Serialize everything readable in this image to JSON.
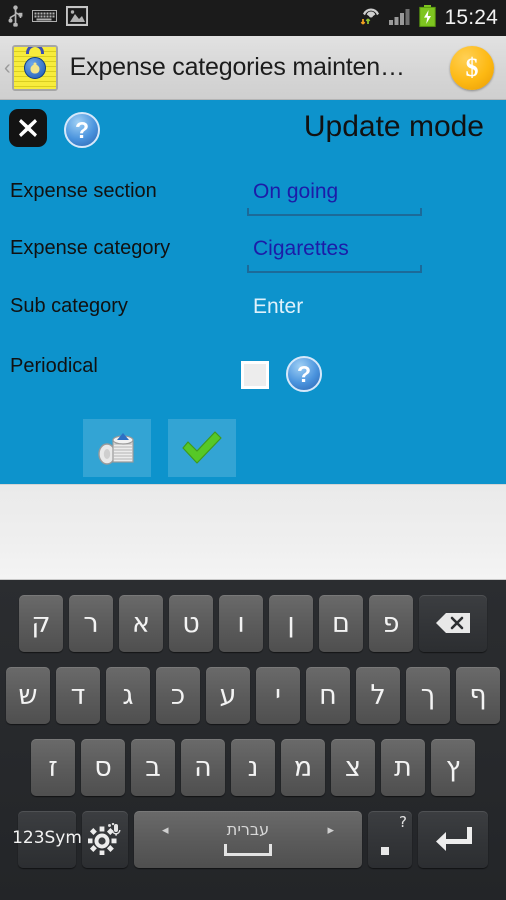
{
  "statusbar": {
    "icons": [
      "usb-icon",
      "keyboard-icon",
      "screenshot-image-icon"
    ],
    "right_icons": [
      "wifi-data-icon",
      "cellular-signal-icon",
      "battery-charging-icon"
    ],
    "clock": "15:24"
  },
  "titlebar": {
    "back_chevron": "‹",
    "app_icon": "expense-clipboard-icon",
    "title": "Expense categories mainten…",
    "coin_symbol": "$"
  },
  "form": {
    "close_label": "✕",
    "help_label": "?",
    "mode_title": "Update mode",
    "fields": [
      {
        "label": "Expense section",
        "value": "On going",
        "style": "underlined"
      },
      {
        "label": "Expense category",
        "value": "Cigarettes",
        "style": "underlined"
      },
      {
        "label": "Sub category",
        "value": "Enter",
        "style": "placeholder"
      }
    ],
    "periodical": {
      "label": "Periodical",
      "checked": false,
      "help_label": "?"
    },
    "actions": [
      {
        "name": "coins-button",
        "icon": "coins-stack-icon"
      },
      {
        "name": "confirm-button",
        "icon": "green-check-icon"
      }
    ]
  },
  "keyboard": {
    "language": "עברית",
    "rows": [
      [
        "ק",
        "ר",
        "א",
        "ט",
        "ו",
        "ן",
        "ם",
        "פ"
      ],
      [
        "ש",
        "ד",
        "ג",
        "כ",
        "ע",
        "י",
        "ח",
        "ל",
        "ך",
        "ף"
      ],
      [
        "ז",
        "ס",
        "ב",
        "ה",
        "נ",
        "מ",
        "צ",
        "ת",
        "ץ"
      ]
    ],
    "backspace_icon": "backspace-icon",
    "sym_label": "123\nSym",
    "sym_line1": "123",
    "sym_line2": "Sym",
    "settings_icon": "settings-gear-mic-icon",
    "arrow_left": "◂",
    "arrow_right": "▸",
    "punc_q": "?",
    "enter_icon": "enter-return-icon"
  },
  "colors": {
    "panel_cyan": "#0d93cc",
    "value_blue": "#1c1ca8",
    "accent_coin": "#fdb913",
    "check_green": "#5dc832"
  }
}
